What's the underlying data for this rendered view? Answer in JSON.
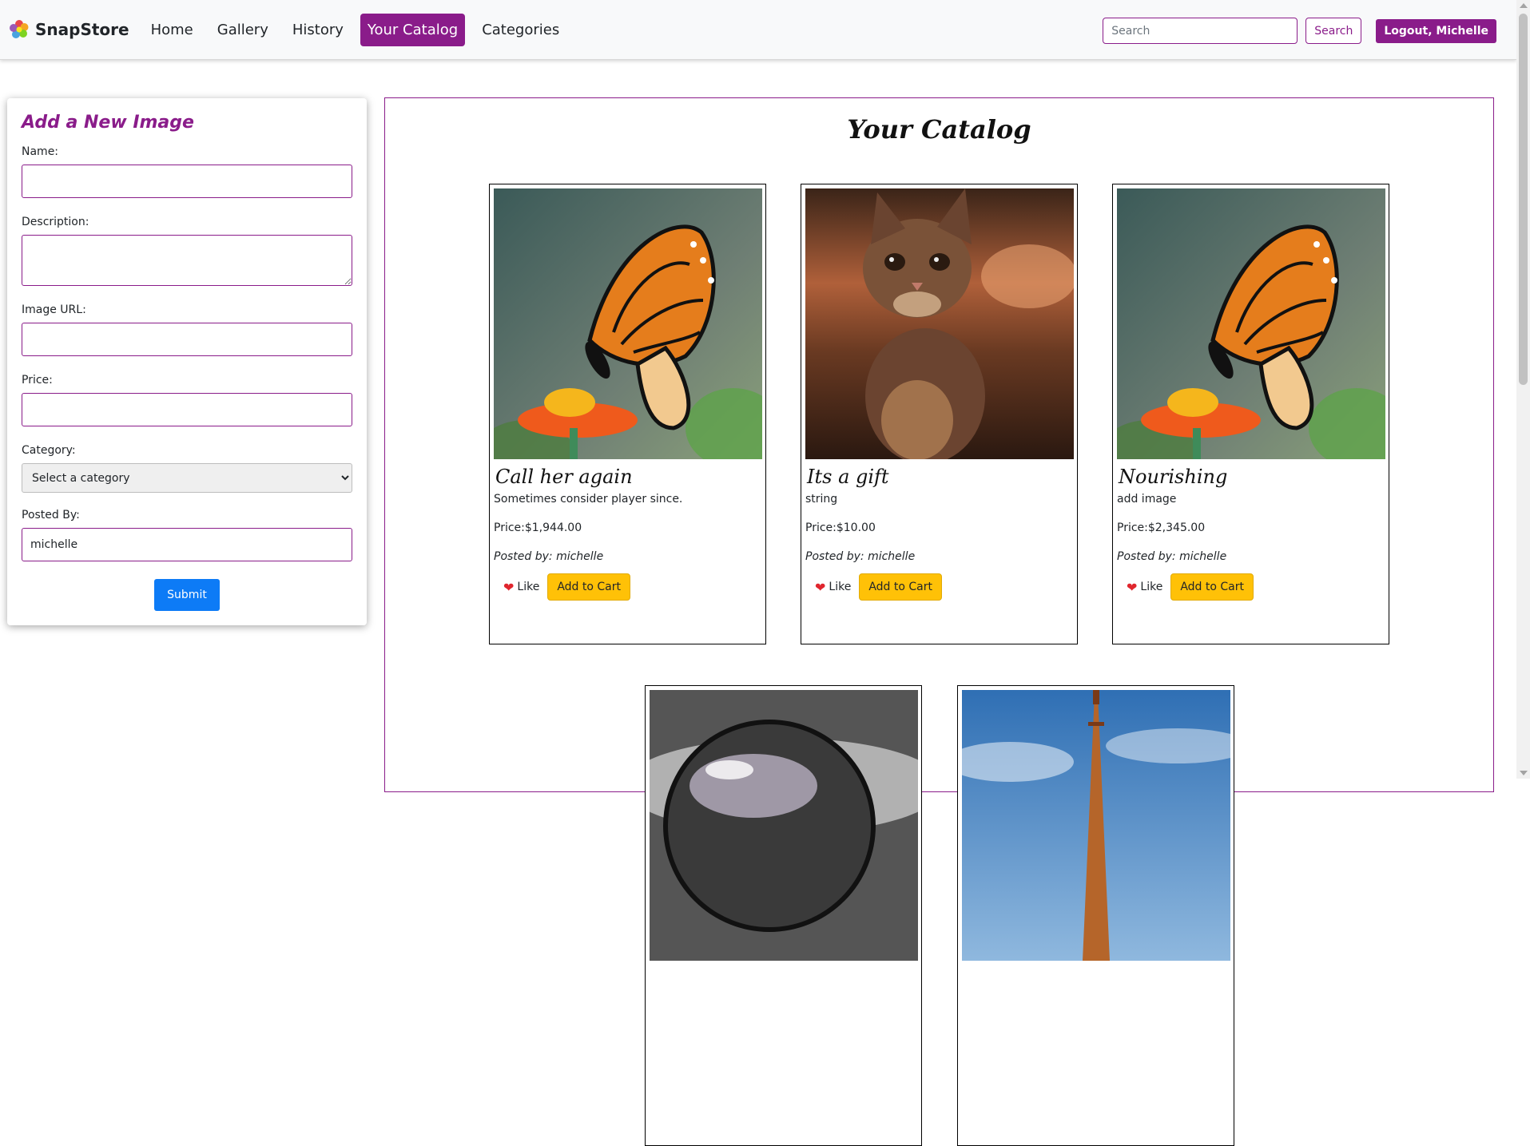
{
  "navbar": {
    "brand": "SnapStore",
    "links": [
      {
        "label": "Home"
      },
      {
        "label": "Gallery"
      },
      {
        "label": "History"
      },
      {
        "label": "Your Catalog",
        "active": true
      },
      {
        "label": "Categories"
      }
    ],
    "search_placeholder": "Search",
    "search_button": "Search",
    "logout_button": "Logout, Michelle"
  },
  "form": {
    "title": "Add a New Image",
    "name_label": "Name:",
    "description_label": "Description:",
    "image_url_label": "Image URL:",
    "price_label": "Price:",
    "category_label": "Category:",
    "category_selected": "Select a category",
    "posted_by_label": "Posted By:",
    "posted_by_value": "michelle",
    "submit_button": "Submit"
  },
  "catalog": {
    "title": "Your Catalog",
    "like_label": "Like",
    "cart_label": "Add to Cart",
    "cards": [
      {
        "title": "Call her again",
        "description": "Sometimes consider player since.",
        "price": "Price:$1,944.00",
        "posted_by": "Posted by: michelle",
        "image": "butterfly"
      },
      {
        "title": "Its a gift",
        "description": "string",
        "price": "Price:$10.00",
        "posted_by": "Posted by: michelle",
        "image": "kitten"
      },
      {
        "title": "Nourishing",
        "description": "add image",
        "price": "Price:$2,345.00",
        "posted_by": "Posted by: michelle",
        "image": "butterfly"
      },
      {
        "image": "bubble"
      },
      {
        "image": "eiffel-tower"
      }
    ]
  },
  "colors": {
    "accent": "#8a1c8a",
    "submit": "#0d7bf6",
    "cart": "#ffc107",
    "heart": "#e0262e"
  }
}
